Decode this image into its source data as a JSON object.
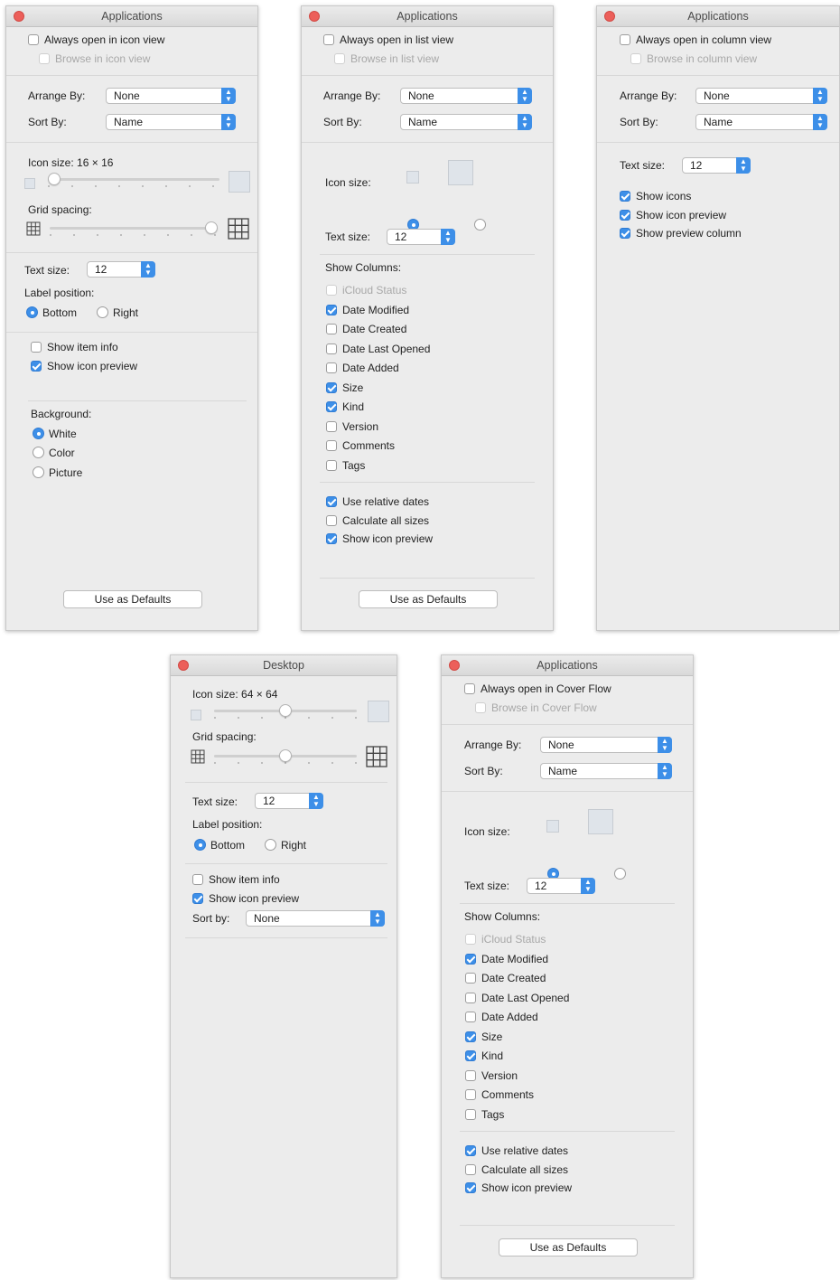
{
  "panels": {
    "icon_view": {
      "title": "Applications",
      "always_open": "Always open in icon view",
      "browse": "Browse in icon view",
      "arrange_label": "Arrange By:",
      "arrange_value": "None",
      "sort_label": "Sort By:",
      "sort_value": "Name",
      "icon_size_label": "Icon size:",
      "icon_size_value": "16 × 16",
      "icon_size_fraction": 0.0,
      "grid_spacing_label": "Grid spacing:",
      "grid_spacing_fraction": 1.0,
      "text_size_label": "Text size:",
      "text_size_value": "12",
      "label_position_label": "Label position:",
      "bottom": "Bottom",
      "right": "Right",
      "show_item_info": "Show item info",
      "show_icon_preview": "Show icon preview",
      "background_label": "Background:",
      "bg_white": "White",
      "bg_color": "Color",
      "bg_picture": "Picture",
      "defaults_button": "Use as Defaults"
    },
    "list_view": {
      "title": "Applications",
      "always_open": "Always open in list view",
      "browse": "Browse in list view",
      "arrange_label": "Arrange By:",
      "arrange_value": "None",
      "sort_label": "Sort By:",
      "sort_value": "Name",
      "icon_size_label": "Icon size:",
      "text_size_label": "Text size:",
      "text_size_value": "12",
      "show_columns_label": "Show Columns:",
      "columns": [
        "iCloud Status",
        "Date Modified",
        "Date Created",
        "Date Last Opened",
        "Date Added",
        "Size",
        "Kind",
        "Version",
        "Comments",
        "Tags"
      ],
      "use_relative_dates": "Use relative dates",
      "calculate_all_sizes": "Calculate all sizes",
      "show_icon_preview": "Show icon preview",
      "defaults_button": "Use as Defaults"
    },
    "column_view": {
      "title": "Applications",
      "always_open": "Always open in column view",
      "browse": "Browse in column view",
      "arrange_label": "Arrange By:",
      "arrange_value": "None",
      "sort_label": "Sort By:",
      "sort_value": "Name",
      "text_size_label": "Text size:",
      "text_size_value": "12",
      "show_icons": "Show icons",
      "show_icon_preview": "Show icon preview",
      "show_preview_column": "Show preview column"
    },
    "desktop": {
      "title": "Desktop",
      "icon_size_label": "Icon size:",
      "icon_size_value": "64 × 64",
      "icon_size_fraction": 0.5,
      "grid_spacing_label": "Grid spacing:",
      "grid_spacing_fraction": 0.5,
      "text_size_label": "Text size:",
      "text_size_value": "12",
      "label_position_label": "Label position:",
      "bottom": "Bottom",
      "right": "Right",
      "show_item_info": "Show item info",
      "show_icon_preview": "Show icon preview",
      "sort_by_label": "Sort by:",
      "sort_by_value": "None"
    },
    "cover_flow": {
      "title": "Applications",
      "always_open": "Always open in Cover Flow",
      "browse": "Browse in Cover Flow",
      "arrange_label": "Arrange By:",
      "arrange_value": "None",
      "sort_label": "Sort By:",
      "sort_value": "Name",
      "icon_size_label": "Icon size:",
      "text_size_label": "Text size:",
      "text_size_value": "12",
      "show_columns_label": "Show Columns:",
      "columns": [
        "iCloud Status",
        "Date Modified",
        "Date Created",
        "Date Last Opened",
        "Date Added",
        "Size",
        "Kind",
        "Version",
        "Comments",
        "Tags"
      ],
      "use_relative_dates": "Use relative dates",
      "calculate_all_sizes": "Calculate all sizes",
      "show_icon_preview": "Show icon preview",
      "defaults_button": "Use as Defaults"
    }
  },
  "colors": {
    "accent": "#3d8fe8",
    "close_button": "#ec5f5a",
    "window_bg": "#ececec"
  },
  "icons": [
    "close-icon",
    "app-icon",
    "grid-icon",
    "popup-arrows-icon"
  ]
}
